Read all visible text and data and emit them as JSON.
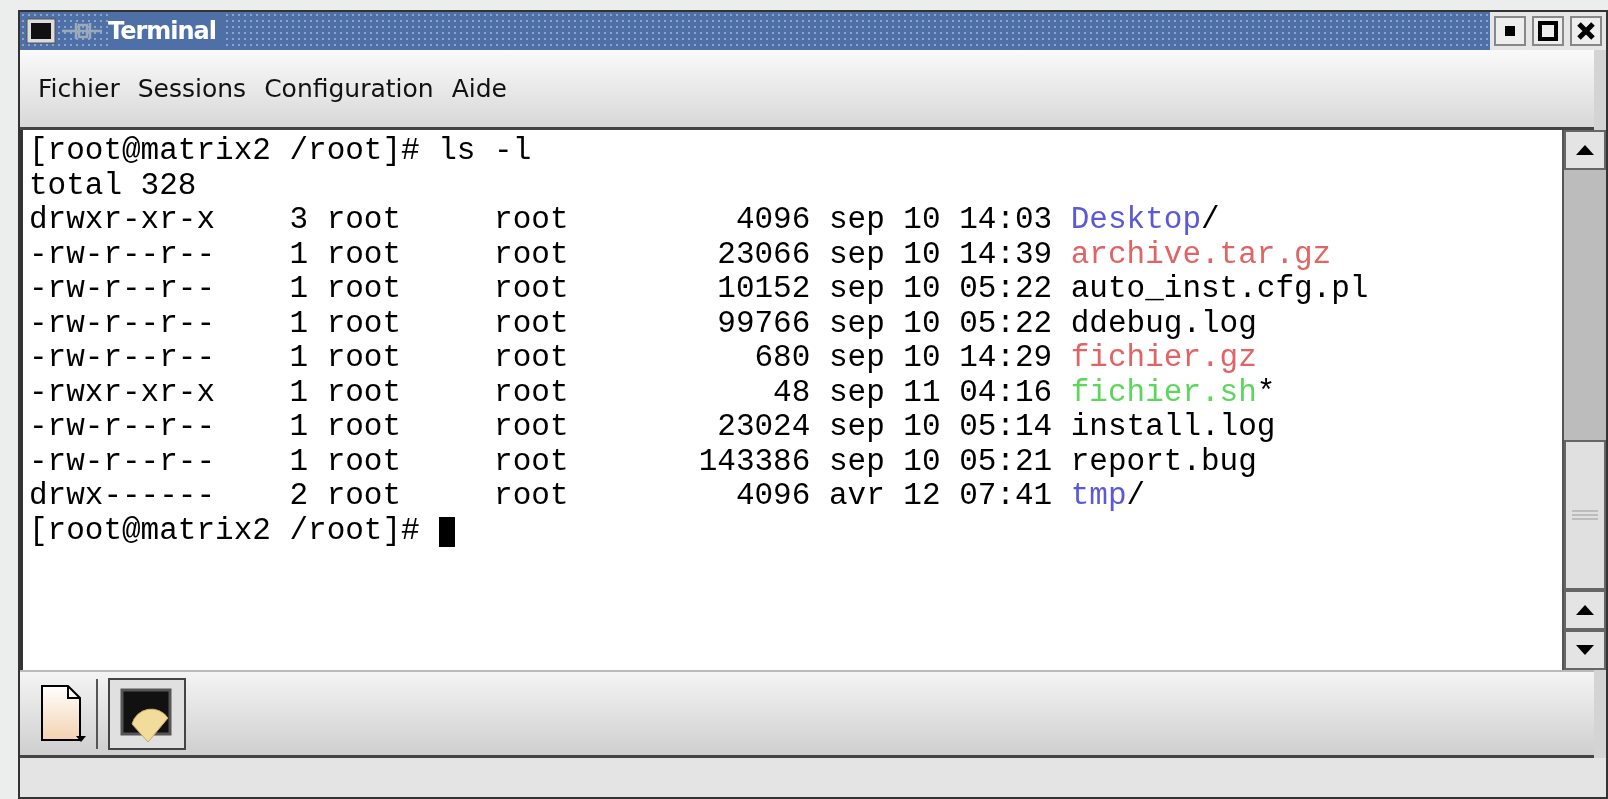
{
  "window": {
    "title": "Terminal"
  },
  "menu": [
    "Fichier",
    "Sessions",
    "Configuration",
    "Aide"
  ],
  "terminal": {
    "lines": [
      {
        "kind": "prompt",
        "text": "[root@matrix2 /root]# ls -l",
        "cursor": false
      },
      {
        "kind": "text",
        "text": "total 328"
      },
      {
        "kind": "entry",
        "details": "drwxr-xr-x    3 root     root         4096 sep 10 14:03",
        "name": "Desktop",
        "color": "#5a5ad8",
        "suffix": "/"
      },
      {
        "kind": "entry",
        "details": "-rw-r--r--    1 root     root        23066 sep 10 14:39",
        "name": "archive.tar.gz",
        "color": "#e06464"
      },
      {
        "kind": "entry",
        "details": "-rw-r--r--    1 root     root        10152 sep 10 05:22",
        "name": "auto_inst.cfg.pl",
        "color": "#000000"
      },
      {
        "kind": "entry",
        "details": "-rw-r--r--    1 root     root        99766 sep 10 05:22",
        "name": "ddebug.log",
        "color": "#000000"
      },
      {
        "kind": "entry",
        "details": "-rw-r--r--    1 root     root          680 sep 10 14:29",
        "name": "fichier.gz",
        "color": "#e06464"
      },
      {
        "kind": "entry",
        "details": "-rwxr-xr-x    1 root     root           48 sep 11 04:16",
        "name": "fichier.sh",
        "color": "#5cd65c",
        "suffix": "*"
      },
      {
        "kind": "entry",
        "details": "-rw-r--r--    1 root     root        23024 sep 10 05:14",
        "name": "install.log",
        "color": "#000000"
      },
      {
        "kind": "entry",
        "details": "-rw-r--r--    1 root     root       143386 sep 10 05:21",
        "name": "report.bug",
        "color": "#000000"
      },
      {
        "kind": "entry",
        "details": "drwx------    2 root     root         4096 avr 12 07:41",
        "name": "tmp",
        "color": "#5a5ad8",
        "suffix": "/"
      },
      {
        "kind": "prompt",
        "text": "[root@matrix2 /root]#",
        "cursor": true
      }
    ]
  }
}
